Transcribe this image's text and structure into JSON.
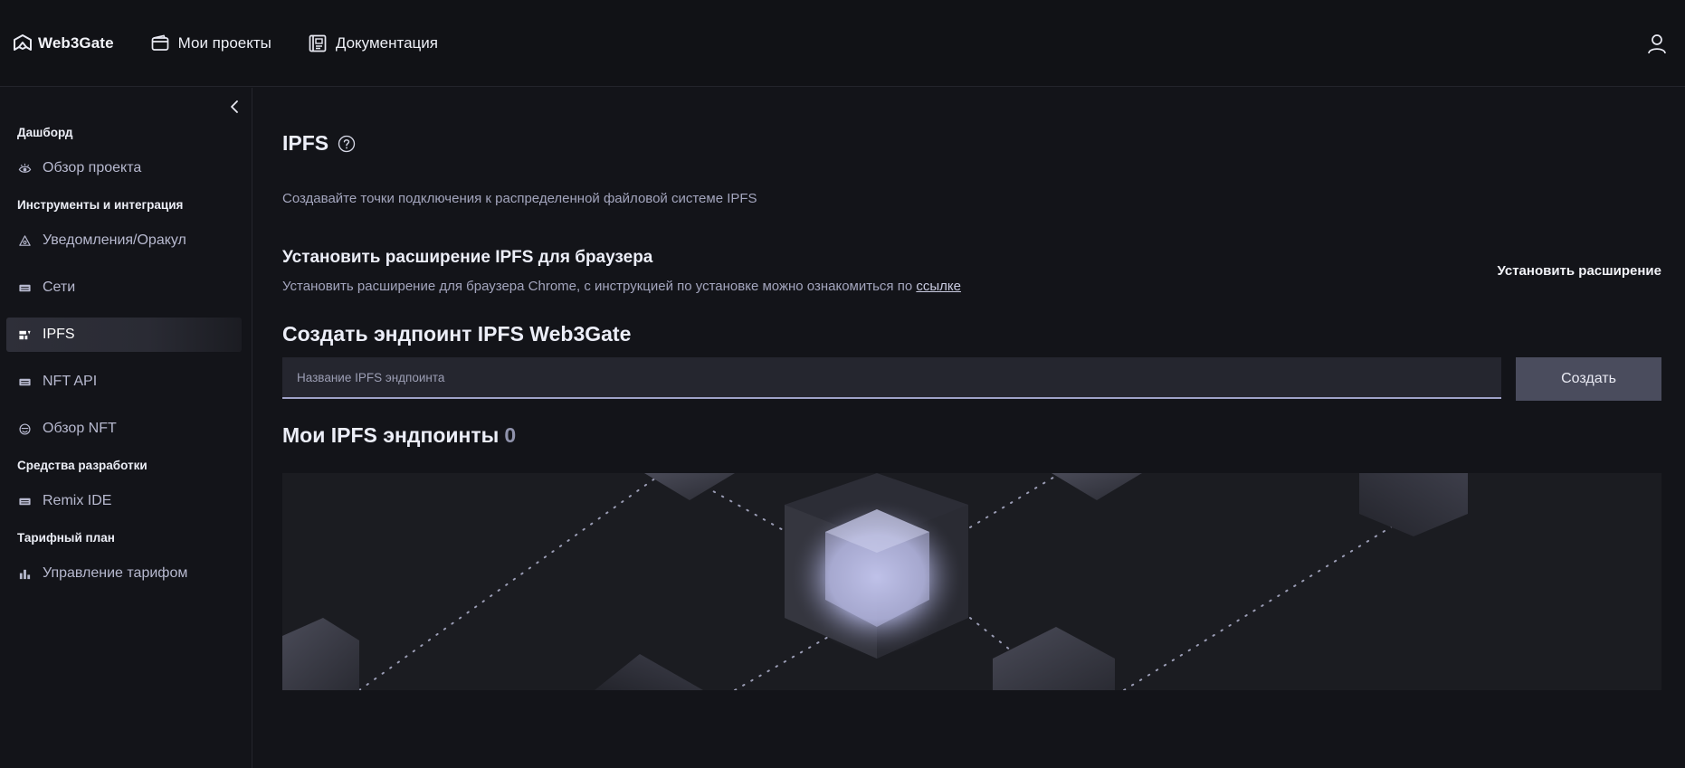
{
  "header": {
    "logo_text": "Web3Gate",
    "nav": [
      {
        "label": "Мои проекты",
        "icon": "wallet-icon"
      },
      {
        "label": "Документация",
        "icon": "docs-icon"
      }
    ],
    "user_icon": "user-icon"
  },
  "sidebar": {
    "sections": [
      {
        "title": "Дашборд"
      },
      {
        "title": "Инструменты и интеграция"
      },
      {
        "title": "Средства разработки"
      },
      {
        "title": "Тарифный план"
      }
    ],
    "items": [
      {
        "label": "Обзор проекта",
        "icon": "eye-icon"
      },
      {
        "label": "Уведомления/Оракул",
        "icon": "bell-icon"
      },
      {
        "label": "Сети",
        "icon": "network-icon"
      },
      {
        "label": "IPFS",
        "icon": "ipfs-icon",
        "active": true
      },
      {
        "label": "NFT API",
        "icon": "api-icon"
      },
      {
        "label": "Обзор NFT",
        "icon": "nft-icon"
      },
      {
        "label": "Remix IDE",
        "icon": "code-icon"
      },
      {
        "label": "Управление тарифом",
        "icon": "chart-bars-icon"
      }
    ]
  },
  "main": {
    "title": "IPFS",
    "subtitle": "Создавайте точки подключения к распределенной файловой системе IPFS",
    "extension": {
      "title": "Установить расширение IPFS для браузера",
      "desc": "Установить расширение для браузера Chrome, с инструкцией по установке можно ознакомиться по",
      "link": "ссылке",
      "install_label": "Установить расширение"
    },
    "create": {
      "title": "Создать эндпоинт IPFS Web3Gate",
      "placeholder": "Название IPFS эндпоинта",
      "button": "Создать"
    },
    "my_endpoints": {
      "title": "Мои IPFS эндпоинты",
      "count": "0"
    }
  },
  "colors": {
    "background": "#131419",
    "accent": "#9fa2c8",
    "button": "#4a4c5d"
  }
}
